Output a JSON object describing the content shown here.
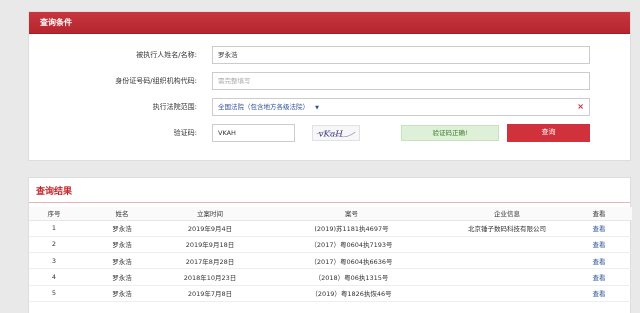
{
  "query_panel": {
    "title": "查询条件",
    "name_label": "被执行人姓名/名称:",
    "name_value": "罗永浩",
    "id_label": "身份证号码/组织机构代码:",
    "id_placeholder": "需完整填写",
    "court_label": "执行法院范围:",
    "court_value": "全国法院（包含地方各级法院）",
    "court_caret": "▼",
    "clear_symbol": "×",
    "captcha_label": "验证码:",
    "captcha_value": "VKAH",
    "captcha_text": "vKaH",
    "verify_status": "验证码正确!",
    "query_button": "查询"
  },
  "results": {
    "title": "查询结果",
    "columns": [
      "序号",
      "姓名",
      "立案时间",
      "案号",
      "企业信息",
      "查看"
    ],
    "rows": [
      {
        "no": "1",
        "name": "罗永浩",
        "date": "2019年9月4日",
        "case": "(2019)苏1181执4697号",
        "company": "北京锤子数码科技有限公司",
        "view": "查看"
      },
      {
        "no": "2",
        "name": "罗永浩",
        "date": "2019年9月18日",
        "case": "（2017）粤0604执7193号",
        "company": "",
        "view": "查看"
      },
      {
        "no": "3",
        "name": "罗永浩",
        "date": "2017年8月28日",
        "case": "（2017）粤0604执6636号",
        "company": "",
        "view": "查看"
      },
      {
        "no": "4",
        "name": "罗永浩",
        "date": "2018年10月23日",
        "case": "（2018）粤06执1315号",
        "company": "",
        "view": "查看"
      },
      {
        "no": "5",
        "name": "罗永浩",
        "date": "2019年7月8日",
        "case": "（2019）粤1826执恢46号",
        "company": "",
        "view": "查看"
      }
    ]
  },
  "colors": {
    "header_red": "#c1272d",
    "link_blue": "#2a4f9a",
    "success_green": "#3c7a2a"
  }
}
